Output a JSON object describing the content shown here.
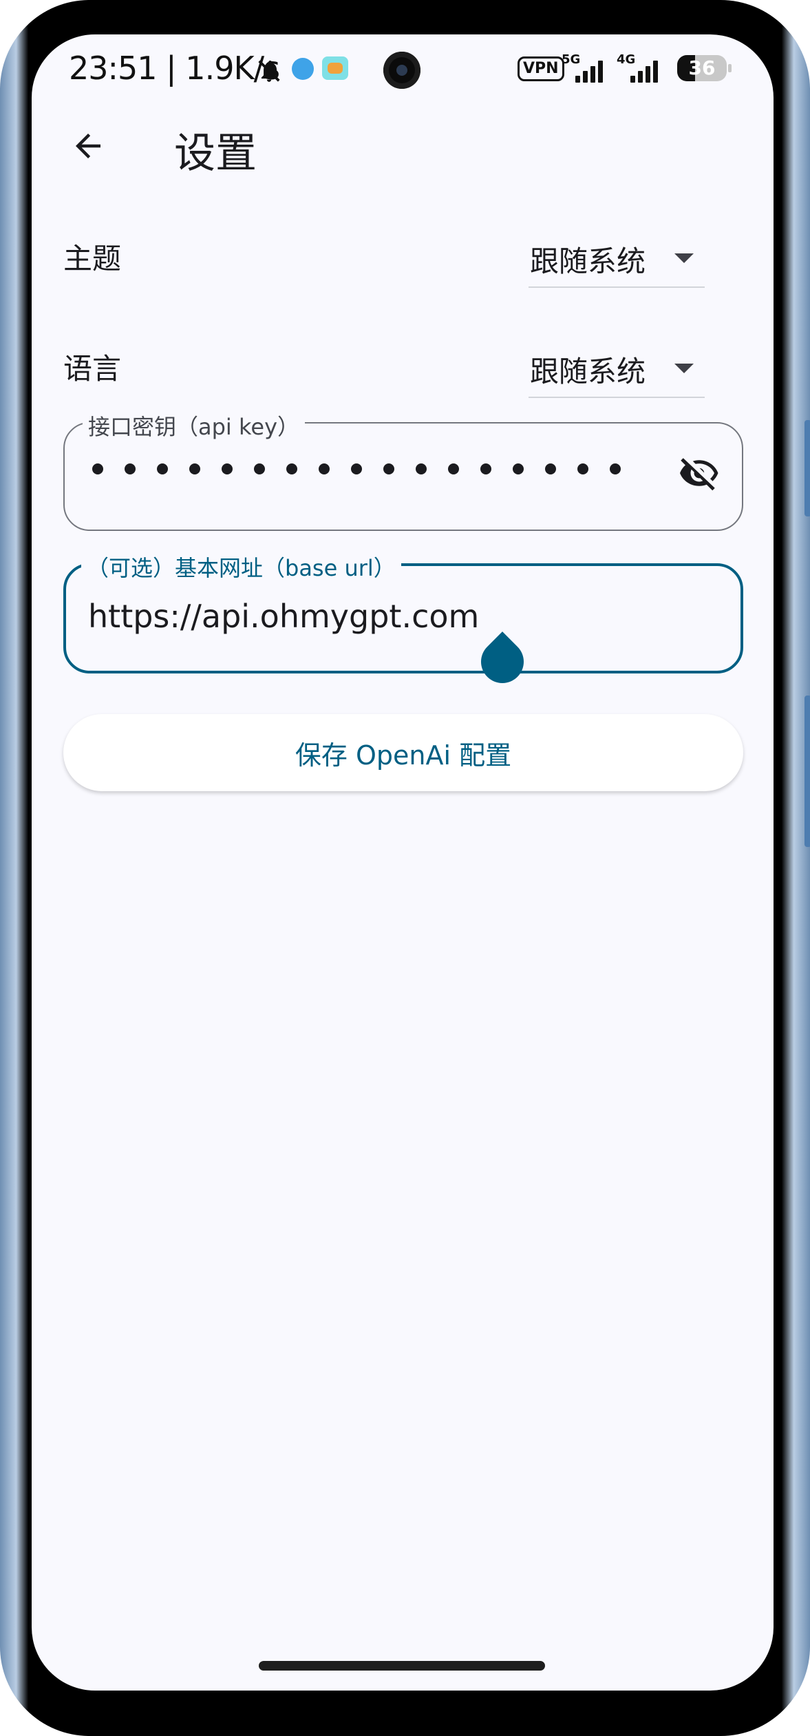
{
  "status_bar": {
    "time_speed": "23:51 | 1.9K/s",
    "vpn": "VPN",
    "network_1": "5G",
    "network_2": "4G",
    "battery": "36",
    "battery_level": 0.36
  },
  "app_bar": {
    "title": "设置"
  },
  "settings": {
    "theme": {
      "label": "主题",
      "value": "跟随系统"
    },
    "language": {
      "label": "语言",
      "value": "跟随系统"
    }
  },
  "api_key_field": {
    "label": "接口密钥（api key）",
    "masked_char_count": 17,
    "toggle_icon": "eye-off-icon"
  },
  "base_url_field": {
    "label": "（可选）基本网址（base url）",
    "value": "https://api.ohmygpt.com"
  },
  "save_button": {
    "label": "保存 OpenAi 配置"
  },
  "colors": {
    "primary": "#005f83",
    "background": "#f9f9fe",
    "text": "#1b1b1f",
    "outline": "#74777f"
  }
}
